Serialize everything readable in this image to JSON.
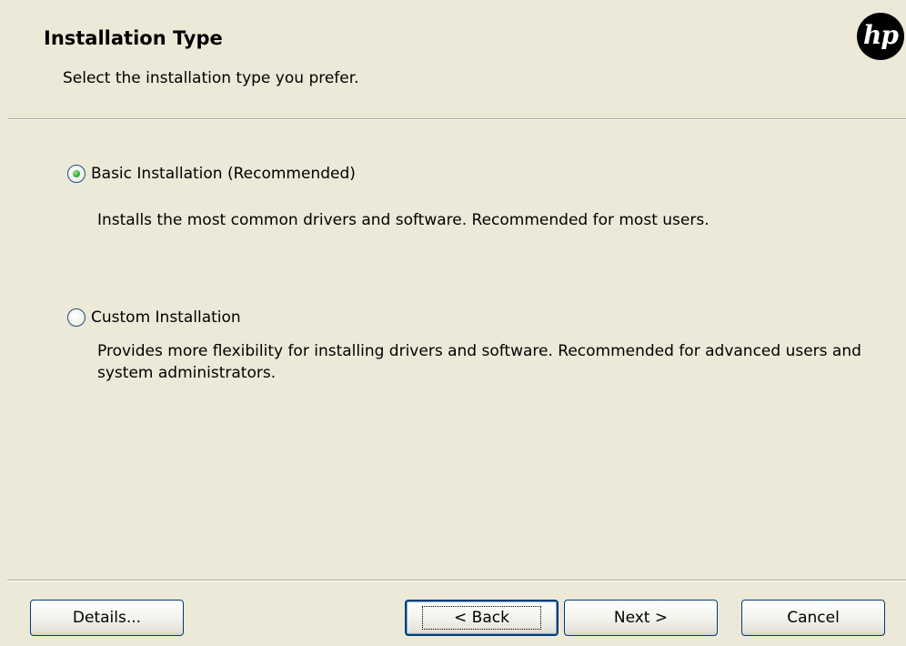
{
  "header": {
    "title": "Installation Type",
    "subtitle": "Select the installation type you prefer.",
    "logo": "hp"
  },
  "options": [
    {
      "label": "Basic Installation (Recommended)",
      "description": "Installs the most common drivers and software.  Recommended for most users.",
      "selected": true
    },
    {
      "label": "Custom Installation",
      "description": "Provides more flexibility for installing drivers and software.  Recommended for advanced users and system administrators.",
      "selected": false
    }
  ],
  "buttons": {
    "details": "Details...",
    "back": "< Back",
    "next": "Next >",
    "cancel": "Cancel"
  },
  "colors": {
    "dialog_bg": "#ece9d8",
    "radio_selected": "#3eae3e",
    "button_border": "#003c74"
  }
}
